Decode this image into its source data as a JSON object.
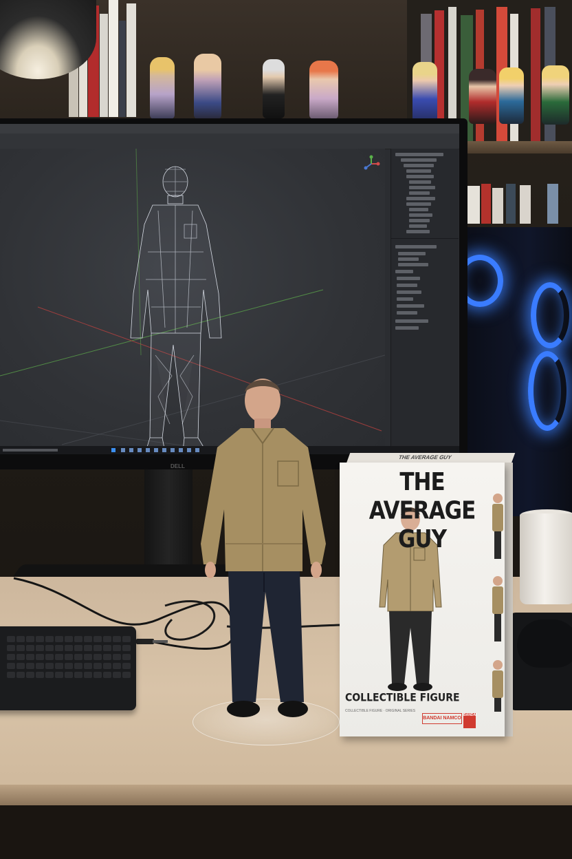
{
  "scene": {
    "description_free": true
  },
  "box": {
    "title": "THE AVERAGE GUY",
    "subtitle": "COLLECTIBLE FIGURE",
    "top_label": "THE AVERAGE GUY",
    "brand_badge": "BANDAI NAMCO",
    "brand_logo": "BANDAI",
    "fineprint": "COLLECTIBLE FIGURE · ORIGINAL SERIES"
  },
  "monitor": {
    "logo": "DELL"
  },
  "colors": {
    "jacket": "#a68f62",
    "jeans": "#1f2533",
    "skin": "#d3a58a",
    "wireframe": "#d8dde6",
    "fan_glow": "#3a7cff",
    "box_red": "#d03a2f"
  },
  "icons": [
    "lamp-icon",
    "axis-gizmo-icon",
    "windows-start-icon"
  ]
}
